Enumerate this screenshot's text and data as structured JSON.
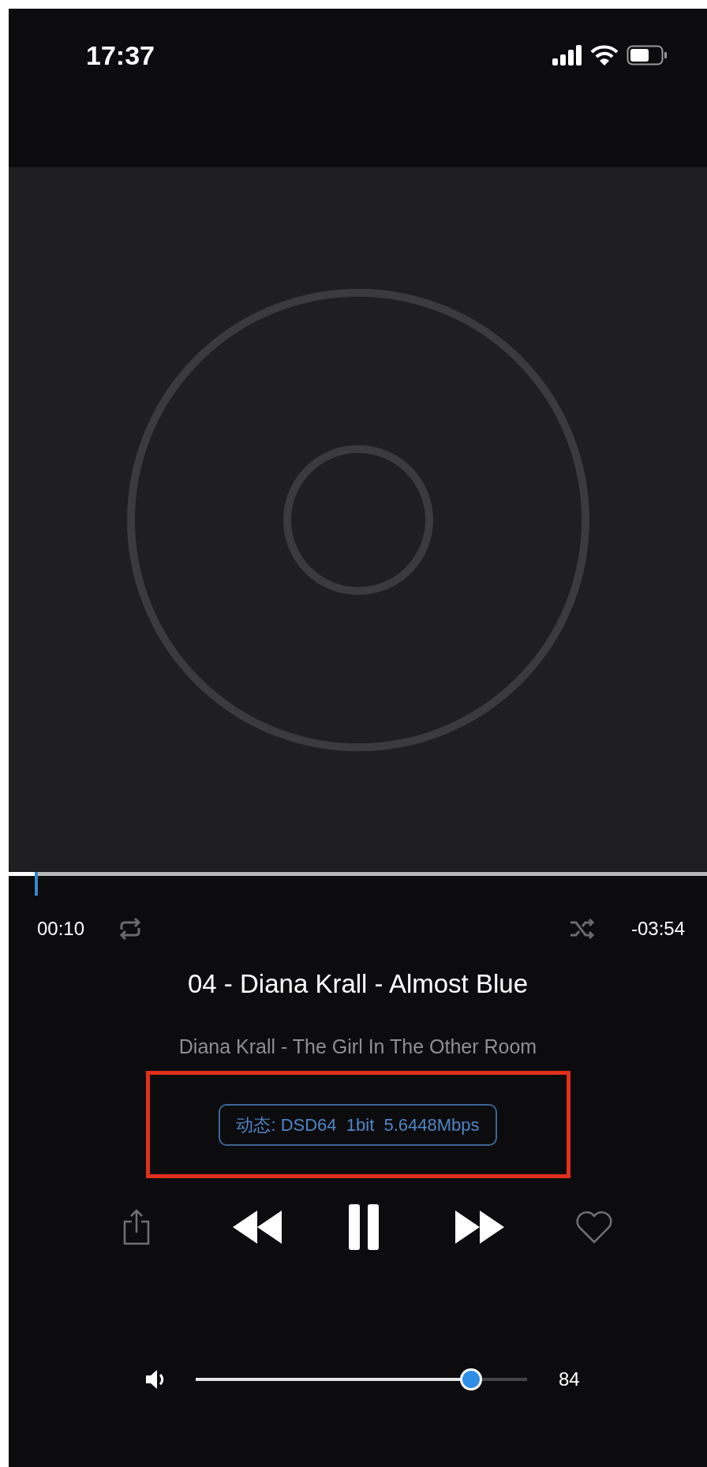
{
  "status_bar": {
    "time": "17:37"
  },
  "progress": {
    "level": 0.04,
    "elapsed": "00:10",
    "remaining": "-03:54",
    "repeat_on": false,
    "shuffle_on": false
  },
  "track": {
    "title": "04 - Diana Krall - Almost Blue",
    "subtitle": "Diana Krall - The Girl In The Other Room"
  },
  "format_badge": "动态: DSD64  1bit  5.6448Mbps",
  "highlight": {
    "color": "#e0301e"
  },
  "controls": {
    "playing": true,
    "favorite": false
  },
  "volume": {
    "level": 0.83,
    "reading": "84"
  }
}
